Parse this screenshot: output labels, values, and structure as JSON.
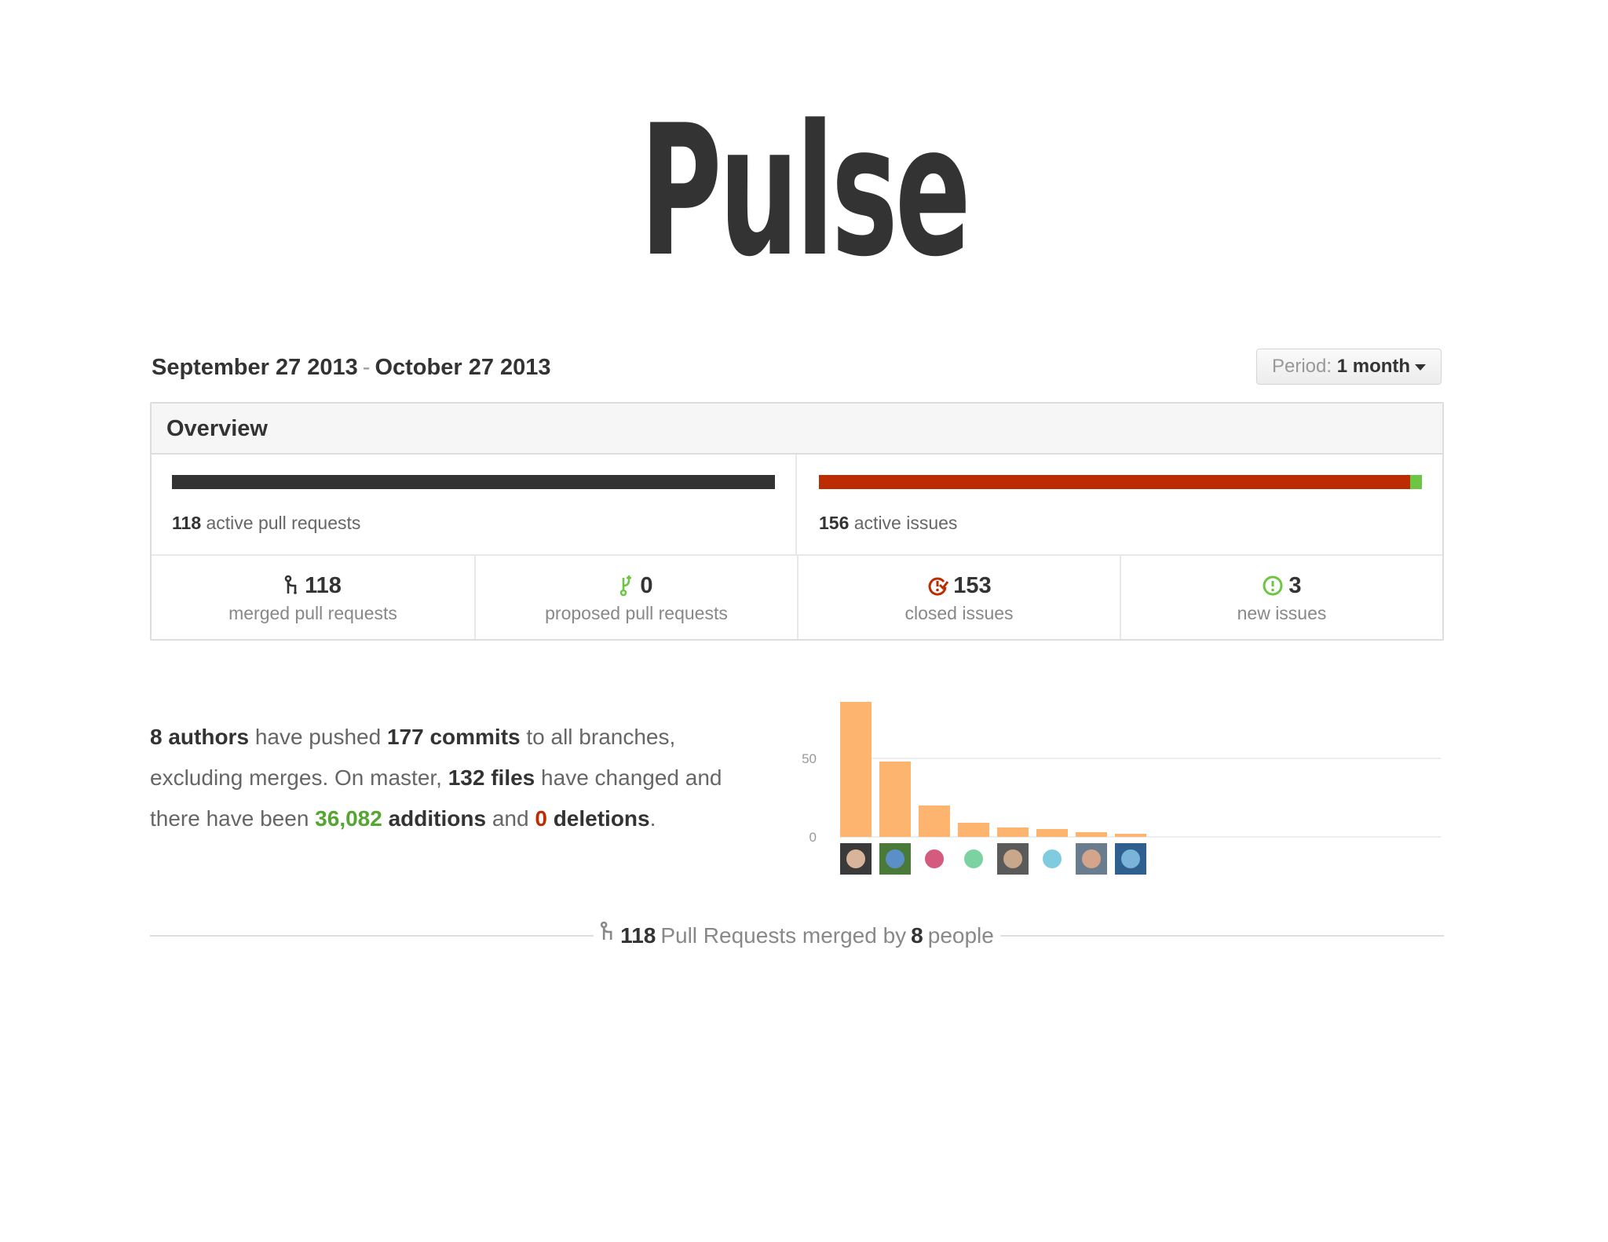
{
  "slide": {
    "title": "Pulse"
  },
  "header": {
    "date_start": "September 27 2013",
    "date_sep": "-",
    "date_end": "October 27 2013",
    "period_label": "Period:",
    "period_value": "1 month"
  },
  "overview": {
    "title": "Overview",
    "pull_requests": {
      "count": "118",
      "label": "active pull requests",
      "bar": [
        {
          "fraction": 1.0,
          "color": "#333333"
        }
      ]
    },
    "issues": {
      "count": "156",
      "label": "active issues",
      "bar": [
        {
          "fraction": 0.981,
          "color": "#bd2c00"
        },
        {
          "fraction": 0.019,
          "color": "#6cc644"
        }
      ]
    },
    "stats": [
      {
        "icon": "git-merge-icon",
        "value": "118",
        "label": "merged pull requests",
        "color": "#333333"
      },
      {
        "icon": "git-pull-request-icon",
        "value": "0",
        "label": "proposed pull requests",
        "color": "#6cc644"
      },
      {
        "icon": "issue-closed-icon",
        "value": "153",
        "label": "closed issues",
        "color": "#bd2c00"
      },
      {
        "icon": "issue-opened-icon",
        "value": "3",
        "label": "new issues",
        "color": "#6cc644"
      }
    ]
  },
  "commits_summary": {
    "authors": "8 authors",
    "t1": "have pushed",
    "commits": "177 commits",
    "t2": "to all branches, excluding merges. On master,",
    "files": "132 files",
    "t3": "have changed and there have been",
    "additions_num": "36,082",
    "additions_word": "additions",
    "t4": "and",
    "deletions_num": "0",
    "deletions_word": "deletions",
    "t5": "."
  },
  "chart_data": {
    "type": "bar",
    "categories": [
      "author-1",
      "author-2",
      "author-3",
      "author-4",
      "author-5",
      "author-6",
      "author-7",
      "author-8"
    ],
    "values": [
      86,
      48,
      20,
      9,
      6,
      5,
      3,
      2
    ],
    "ylim": [
      0,
      90
    ],
    "yticks": [
      "0",
      "50"
    ],
    "ytick_values": [
      0,
      50
    ],
    "bar_color": "#fdb46f",
    "grid": true
  },
  "merged_footer": {
    "count": "118",
    "t1": "Pull Requests merged by",
    "people": "8",
    "t2": "people"
  }
}
